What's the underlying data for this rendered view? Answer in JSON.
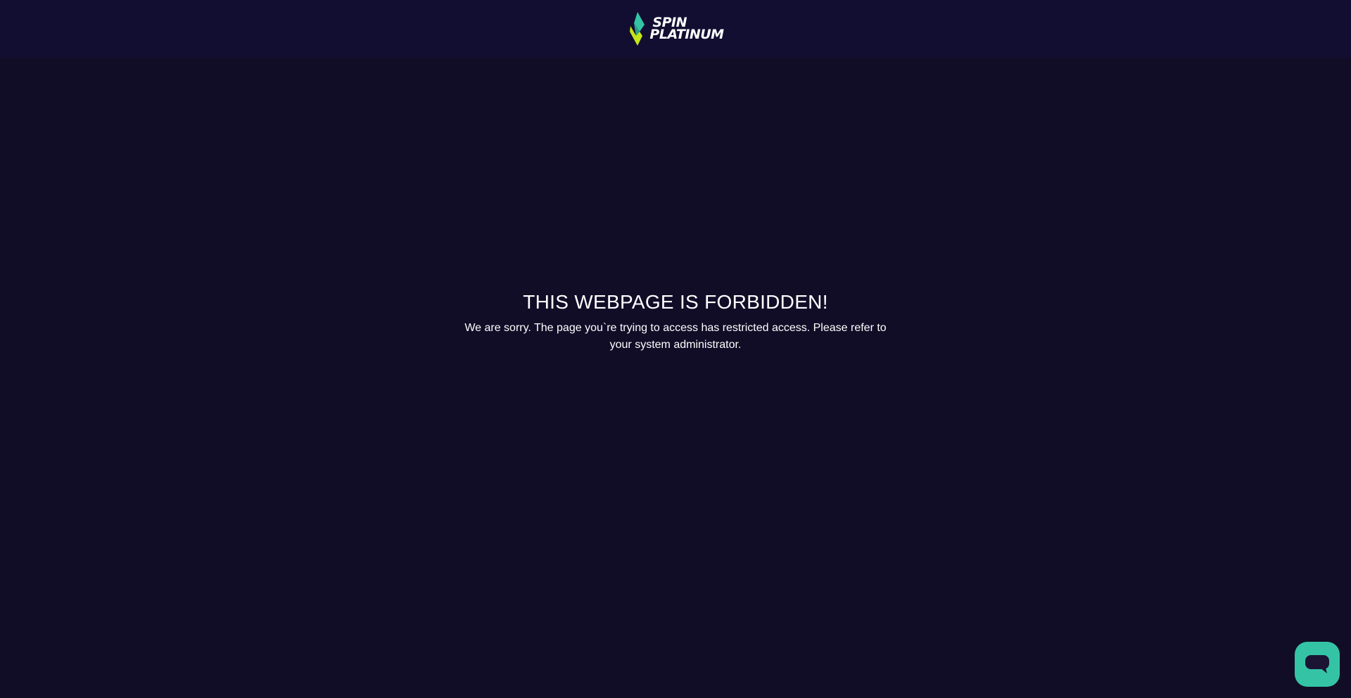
{
  "header": {
    "logo": {
      "line1": "SPIN",
      "line2": "PLATINUM",
      "icon": "diamond-logo-icon",
      "colors": {
        "teal": "#34c4a5",
        "lime": "#c6e617"
      }
    }
  },
  "error": {
    "title": "THIS WEBPAGE IS FORBIDDEN!",
    "message_line1": "We are sorry. The page you`re trying to access has restricted access. Please refer to",
    "message_line2": "your system administrator."
  },
  "chat": {
    "icon": "chat-bubble-icon",
    "color": "#34c4a5"
  },
  "colors": {
    "background": "#110d27",
    "header_background": "#120e32",
    "text": "#ffffff"
  }
}
